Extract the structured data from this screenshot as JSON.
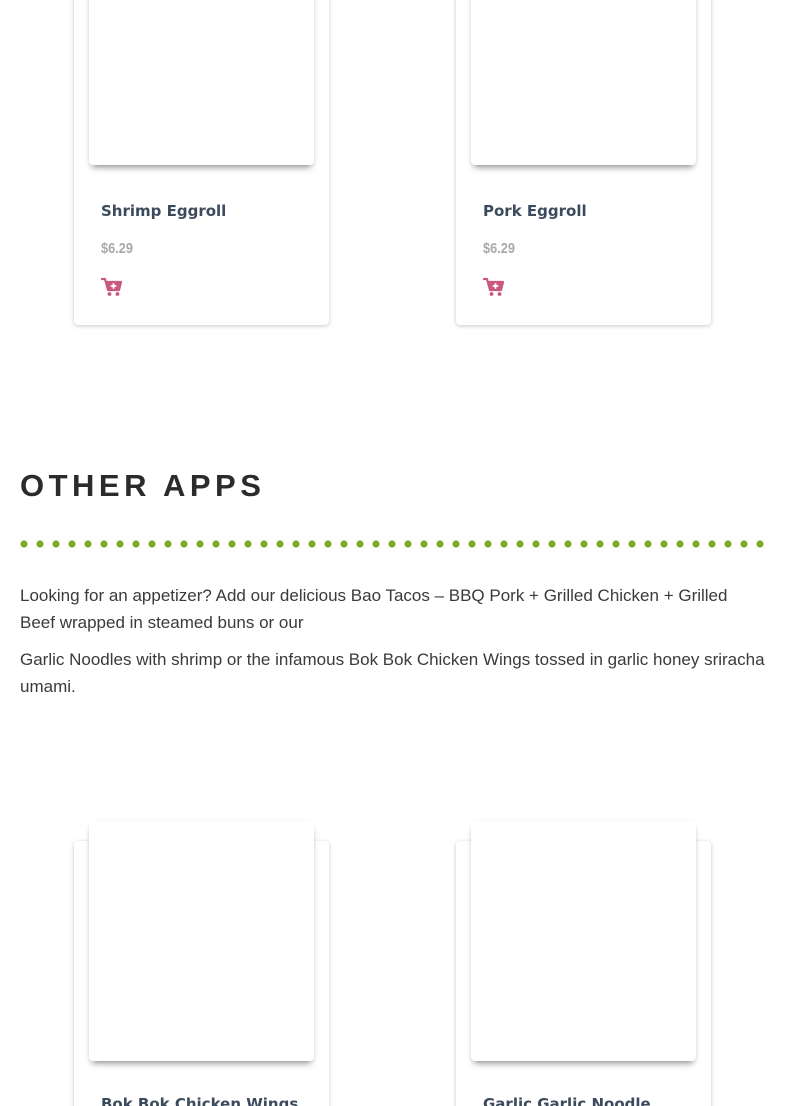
{
  "products_top": [
    {
      "name": "Shrimp Eggroll",
      "price": "$6.29",
      "cart_icon": "cart-plus-icon"
    },
    {
      "name": "Pork Eggroll",
      "price": "$6.29",
      "cart_icon": "cart-plus-icon"
    }
  ],
  "other_apps": {
    "title": "OTHER APPS",
    "divider_color": "#7cab2c",
    "paragraphs": [
      "Looking for an appetizer? Add our delicious Bao Tacos – BBQ Pork + Grilled Chicken + Grilled Beef wrapped in steamed buns or our",
      "Garlic Noodles with shrimp or the infamous Bok Bok Chicken Wings tossed in garlic honey sriracha umami."
    ]
  },
  "products_bottom": [
    {
      "name": "Bok Bok Chicken Wings"
    },
    {
      "name": "Garlic Garlic Noodle"
    }
  ],
  "colors": {
    "product_name": "#3b4a5c",
    "price": "#a9a9a9",
    "cart_icon": "#c9587c",
    "heading": "#2b2b2b"
  }
}
